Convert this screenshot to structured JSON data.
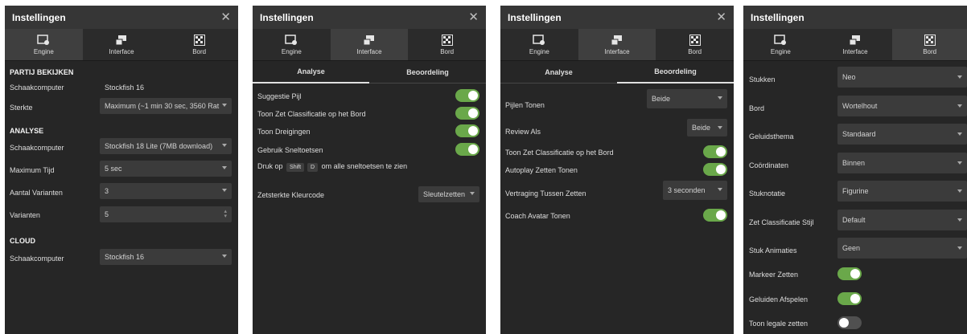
{
  "title": "Instellingen",
  "close_glyph": "✕",
  "tabs": {
    "engine": "Engine",
    "interface": "Interface",
    "board": "Bord"
  },
  "subtabs": {
    "analysis": "Analyse",
    "review": "Beoordeling"
  },
  "engine": {
    "review_section": "PARTIJ BEKIJKEN",
    "review_engine_label": "Schaakcomputer",
    "review_engine_value": "Stockfish 16",
    "strength_label": "Sterkte",
    "strength_value": "Maximum (~1 min 30 sec, 3560 Rat",
    "analysis_section": "ANALYSE",
    "analysis_engine_label": "Schaakcomputer",
    "analysis_engine_value": "Stockfish 18 Lite (7MB download)",
    "max_time_label": "Maximum Tijd",
    "max_time_value": "5 sec",
    "num_variants_label": "Aantal Varianten",
    "num_variants_value": "3",
    "variants_label": "Varianten",
    "variants_value": "5",
    "cloud_section": "CLOUD",
    "cloud_engine_label": "Schaakcomputer",
    "cloud_engine_value": "Stockfish 16"
  },
  "interface_analysis": {
    "suggestion_arrow": "Suggestie Pijl",
    "show_move_classification": "Toon Zet Classificatie op het Bord",
    "show_threats": "Toon Dreigingen",
    "use_shortcuts": "Gebruik Sneltoetsen",
    "shortcut_prefix": "Druk op",
    "shortcut_key1": "Shift",
    "shortcut_key2": "D",
    "shortcut_suffix": "om alle sneltoetsen te zien",
    "strength_color_label": "Zetsterkte Kleurcode",
    "strength_color_value": "Sleutelzetten"
  },
  "interface_review": {
    "show_arrows_label": "Pijlen Tonen",
    "show_arrows_value": "Beide",
    "review_as_label": "Review Als",
    "review_as_value": "Beide",
    "show_move_classification": "Toon Zet Classificatie op het Bord",
    "autoplay_moves": "Autoplay Zetten Tonen",
    "delay_label": "Vertraging Tussen Zetten",
    "delay_value": "3 seconden",
    "coach_avatar": "Coach Avatar Tonen"
  },
  "board": {
    "pieces_label": "Stukken",
    "pieces_value": "Neo",
    "board_label": "Bord",
    "board_value": "Wortelhout",
    "sound_label": "Geluidsthema",
    "sound_value": "Standaard",
    "coords_label": "Coördinaten",
    "coords_value": "Binnen",
    "notation_label": "Stuknotatie",
    "notation_value": "Figurine",
    "class_style_label": "Zet Classificatie Stijl",
    "class_style_value": "Default",
    "animation_label": "Stuk Animaties",
    "animation_value": "Geen",
    "highlight_moves": "Markeer Zetten",
    "play_sounds": "Geluiden Afspelen",
    "legal_moves": "Toon legale zetten"
  },
  "toggles": {
    "suggestion_arrow": true,
    "show_move_classification": true,
    "show_threats": true,
    "use_shortcuts": true,
    "review_show_move_classification": true,
    "autoplay_moves": true,
    "coach_avatar": true,
    "highlight_moves": true,
    "play_sounds": true,
    "legal_moves": false
  },
  "colors": {
    "panel": "#262626",
    "titlebar": "#363636",
    "accent_green": "#6aa84a",
    "active_tab": "#3f3f3f"
  },
  "icons": {
    "engine": "engine-icon",
    "interface": "interface-icon",
    "board": "chessboard-icon",
    "close": "close-icon"
  }
}
